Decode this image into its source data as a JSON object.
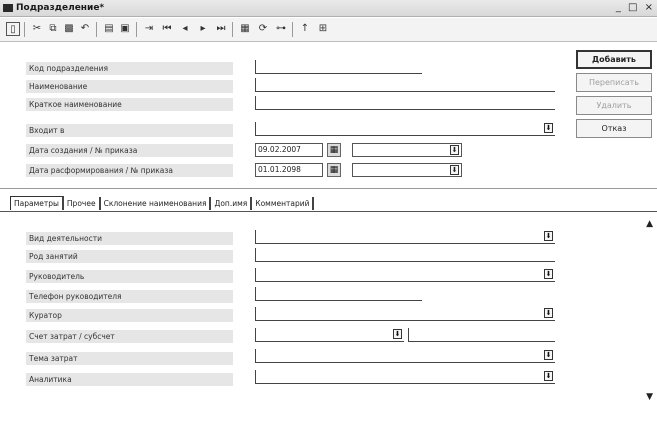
{
  "window": {
    "title": "Подразделение*",
    "buttons": "_ □ ×"
  },
  "toolbar_icons": [
    "new-doc-icon",
    "cut-icon",
    "copy-icon",
    "paste-icon",
    "undo-icon",
    "print-icon",
    "preview-icon",
    "goto-icon",
    "first-icon",
    "prev-icon",
    "next-icon",
    "last-icon",
    "form-icon",
    "refresh-icon",
    "tree-icon",
    "up-arrow-icon",
    "filter-icon"
  ],
  "header_fields": [
    {
      "label": "Код подразделения",
      "value": ""
    },
    {
      "label": "Наименование",
      "value": ""
    },
    {
      "label": "Краткое наименование",
      "value": ""
    },
    {
      "label": "Входит в",
      "value": ""
    },
    {
      "label": "Дата создания / № приказа",
      "date": "09.02.2007",
      "order": ""
    },
    {
      "label": "Дата расформирования / № приказа",
      "date": "01.01.2098",
      "order": ""
    }
  ],
  "side_buttons": {
    "add": "Добавить",
    "rewrite": "Переписать",
    "delete": "Удалить",
    "cancel": "Отказ"
  },
  "tabs": [
    "Параметры",
    "Прочее",
    "Склонение наименования",
    "Доп.имя",
    "Комментарий"
  ],
  "param_fields": [
    {
      "label": "Вид деятельности",
      "value": ""
    },
    {
      "label": "Род занятий",
      "value": ""
    },
    {
      "label": "Руководитель",
      "value": ""
    },
    {
      "label": "Телефон руководителя",
      "value": ""
    },
    {
      "label": "Куратор",
      "value": ""
    },
    {
      "label": "Счет затрат / субсчет",
      "value": "",
      "value2": ""
    },
    {
      "label": "Тема затрат",
      "value": ""
    },
    {
      "label": "Аналитика",
      "value": ""
    }
  ],
  "dropdown_glyph": "⬇",
  "calendar_glyph": "▦",
  "scroll_up": "▲",
  "scroll_down": "▼"
}
